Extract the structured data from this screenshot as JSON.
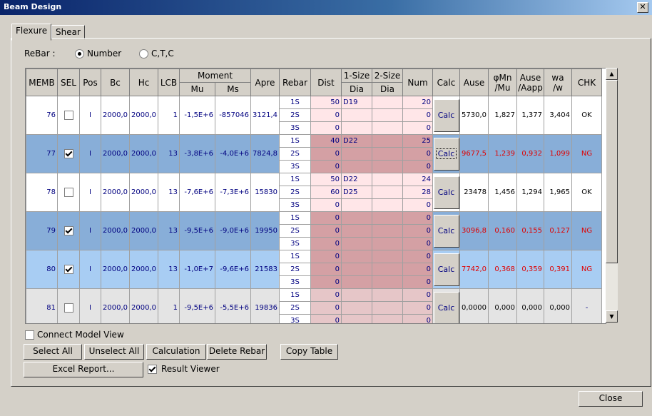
{
  "window": {
    "title": "Beam Design",
    "close_glyph": "✕"
  },
  "tabs": [
    {
      "label": "Flexure",
      "active": true
    },
    {
      "label": "Shear",
      "active": false
    }
  ],
  "rebar": {
    "label": "ReBar :",
    "options": [
      {
        "label": "Number",
        "selected": true
      },
      {
        "label": "C,T,C",
        "selected": false
      }
    ]
  },
  "headers": {
    "memb": "MEMB",
    "sel": "SEL",
    "pos": "Pos",
    "bc": "Bc",
    "hc": "Hc",
    "lcb": "LCB",
    "moment": "Moment",
    "mu": "Mu",
    "ms": "Ms",
    "apre": "Apre",
    "rebar": "Rebar",
    "dist": "Dist",
    "size1": "1-Size",
    "size2": "2-Size",
    "dia1": "Dia",
    "dia2": "Dia",
    "num": "Num",
    "calc": "Calc",
    "ause": "Ause",
    "phimn_1": "φMn",
    "phimn_2": "/Mu",
    "auseaapp_1": "Ause",
    "auseaapp_2": "/Aapp",
    "waw_1": "wa",
    "waw_2": "/w",
    "chk": "CHK"
  },
  "rows": [
    {
      "memb": "76",
      "sel": false,
      "pos": "I",
      "bc": "2000,0",
      "hc": "2000,0",
      "lcb": "1",
      "mu": "-1,5E+6",
      "ms": "-857046",
      "apre": "3121,4",
      "rebar": [
        {
          "layer": "1S",
          "dist": "50",
          "dia1": "D19",
          "dia2": "",
          "num": "20"
        },
        {
          "layer": "2S",
          "dist": "0",
          "dia1": "",
          "dia2": "",
          "num": "0"
        },
        {
          "layer": "3S",
          "dist": "0",
          "dia1": "",
          "dia2": "",
          "num": "0"
        }
      ],
      "calc": "Calc",
      "ause": "5730,0",
      "phimn": "1,827",
      "aapp": "1,377",
      "waw": "3,404",
      "chk": "OK",
      "style": "white",
      "ng": false
    },
    {
      "memb": "77",
      "sel": true,
      "pos": "I",
      "bc": "2000,0",
      "hc": "2000,0",
      "lcb": "13",
      "mu": "-3,8E+6",
      "ms": "-4,0E+6",
      "apre": "7824,8",
      "rebar": [
        {
          "layer": "1S",
          "dist": "40",
          "dia1": "D22",
          "dia2": "",
          "num": "25"
        },
        {
          "layer": "2S",
          "dist": "0",
          "dia1": "",
          "dia2": "",
          "num": "0"
        },
        {
          "layer": "3S",
          "dist": "0",
          "dia1": "",
          "dia2": "",
          "num": "0"
        }
      ],
      "calc": "Calc",
      "ause": "9677,5",
      "phimn": "1,239",
      "aapp": "0,932",
      "waw": "1,099",
      "chk": "NG",
      "style": "blue",
      "ng": true
    },
    {
      "memb": "78",
      "sel": false,
      "pos": "I",
      "bc": "2000,0",
      "hc": "2000,0",
      "lcb": "13",
      "mu": "-7,6E+6",
      "ms": "-7,3E+6",
      "apre": "15830",
      "rebar": [
        {
          "layer": "1S",
          "dist": "50",
          "dia1": "D22",
          "dia2": "",
          "num": "24"
        },
        {
          "layer": "2S",
          "dist": "60",
          "dia1": "D25",
          "dia2": "",
          "num": "28"
        },
        {
          "layer": "3S",
          "dist": "0",
          "dia1": "",
          "dia2": "",
          "num": "0"
        }
      ],
      "calc": "Calc",
      "ause": "23478",
      "phimn": "1,456",
      "aapp": "1,294",
      "waw": "1,965",
      "chk": "OK",
      "style": "white",
      "ng": false
    },
    {
      "memb": "79",
      "sel": true,
      "pos": "I",
      "bc": "2000,0",
      "hc": "2000,0",
      "lcb": "13",
      "mu": "-9,5E+6",
      "ms": "-9,0E+6",
      "apre": "19950",
      "rebar": [
        {
          "layer": "1S",
          "dist": "0",
          "dia1": "",
          "dia2": "",
          "num": "0"
        },
        {
          "layer": "2S",
          "dist": "0",
          "dia1": "",
          "dia2": "",
          "num": "0"
        },
        {
          "layer": "3S",
          "dist": "0",
          "dia1": "",
          "dia2": "",
          "num": "0"
        }
      ],
      "calc": "Calc",
      "ause": "3096,8",
      "phimn": "0,160",
      "aapp": "0,155",
      "waw": "0,127",
      "chk": "NG",
      "style": "blue",
      "ng": true
    },
    {
      "memb": "80",
      "sel": true,
      "pos": "I",
      "bc": "2000,0",
      "hc": "2000,0",
      "lcb": "13",
      "mu": "-1,0E+7",
      "ms": "-9,6E+6",
      "apre": "21583",
      "rebar": [
        {
          "layer": "1S",
          "dist": "0",
          "dia1": "",
          "dia2": "",
          "num": "0"
        },
        {
          "layer": "2S",
          "dist": "0",
          "dia1": "",
          "dia2": "",
          "num": "0"
        },
        {
          "layer": "3S",
          "dist": "0",
          "dia1": "",
          "dia2": "",
          "num": "0"
        }
      ],
      "calc": "Calc",
      "ause": "7742,0",
      "phimn": "0,368",
      "aapp": "0,359",
      "waw": "0,391",
      "chk": "NG",
      "style": "lightblue",
      "ng": true
    },
    {
      "memb": "81",
      "sel": false,
      "pos": "I",
      "bc": "2000,0",
      "hc": "2000,0",
      "lcb": "1",
      "mu": "-9,5E+6",
      "ms": "-5,5E+6",
      "apre": "19836",
      "rebar": [
        {
          "layer": "1S",
          "dist": "0",
          "dia1": "",
          "dia2": "",
          "num": "0"
        },
        {
          "layer": "2S",
          "dist": "0",
          "dia1": "",
          "dia2": "",
          "num": "0"
        },
        {
          "layer": "3S",
          "dist": "0",
          "dia1": "",
          "dia2": "",
          "num": "0"
        }
      ],
      "calc": "Calc",
      "ause": "0,0000",
      "phimn": "0,000",
      "aapp": "0,000",
      "waw": "0,000",
      "chk": "-",
      "style": "gray",
      "ng": false
    }
  ],
  "scroll": {
    "up": "▲",
    "down": "▼"
  },
  "controls": {
    "connect_model_view": {
      "label": "Connect Model View",
      "checked": false
    },
    "result_viewer": {
      "label": "Result Viewer",
      "checked": true
    },
    "select_all": "Select All",
    "unselect_all": "Unselect All",
    "calculation": "Calculation",
    "delete_rebar": "Delete Rebar",
    "copy_table": "Copy Table",
    "excel_report": "Excel Report...",
    "close": "Close"
  },
  "colors": {
    "white": {
      "row": "#ffffff",
      "rebar": "#ffe6e8"
    },
    "blue": {
      "row": "#88aed8",
      "rebar": "#d4a0a4"
    },
    "lightblue": {
      "row": "#a8cdf3",
      "rebar": "#d4a0a4"
    },
    "gray": {
      "row": "#e4e4e4",
      "rebar": "#e6c6c8"
    }
  }
}
